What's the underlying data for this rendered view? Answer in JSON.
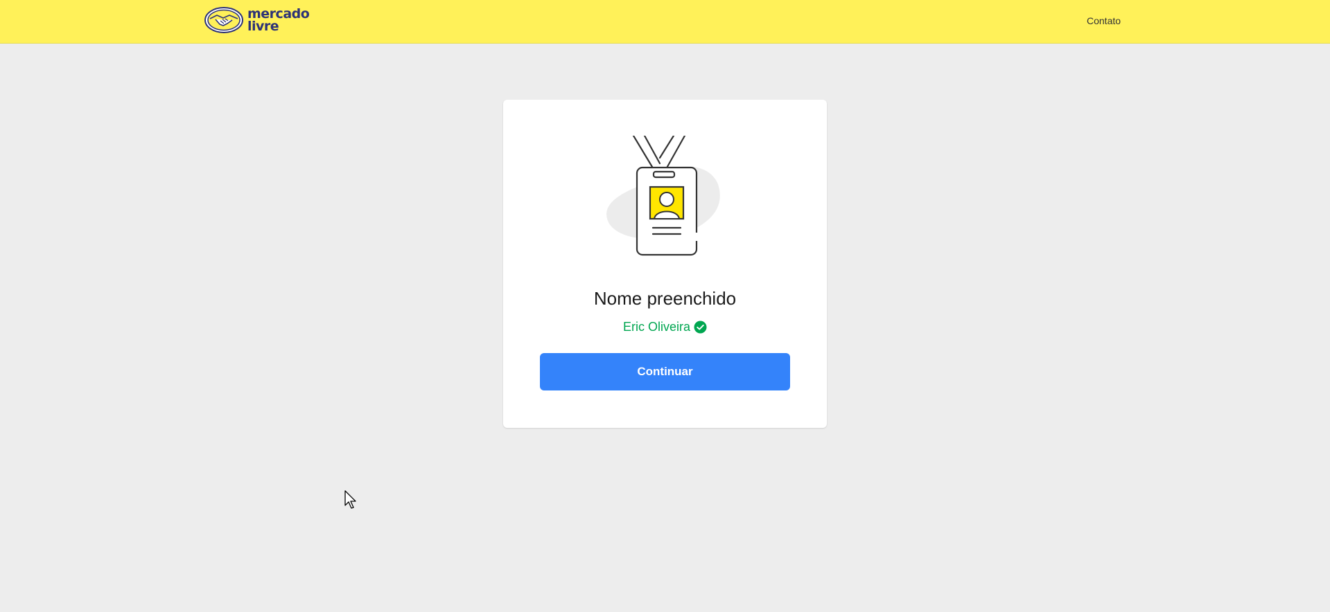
{
  "header": {
    "logo_text_line1": "mercado",
    "logo_text_line2": "livre",
    "contact_link": "Contato"
  },
  "card": {
    "illustration": "id-badge-illustration",
    "title": "Nome preenchido",
    "name_value": "Eric Oliveira",
    "name_status_icon": "check-circle-icon",
    "continue_button": "Continuar"
  },
  "colors": {
    "header_bg": "#fff159",
    "page_bg": "#ededed",
    "primary_button": "#3483fa",
    "success_green": "#00a650",
    "badge_photo_yellow": "#ffe600"
  }
}
